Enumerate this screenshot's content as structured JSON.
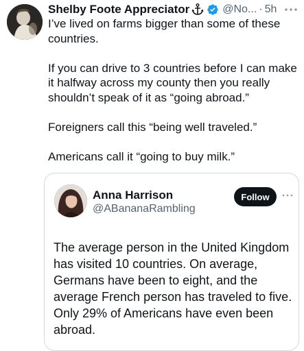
{
  "tweet": {
    "author": {
      "display_name": "Shelby Foote Appreciator",
      "badge_icon": "anchor-icon",
      "verified_icon": "verified-badge-icon",
      "verified_color": "#1d9bf0",
      "handle": "@No...",
      "separator": "·",
      "time": "5h"
    },
    "more_icon": "more-icon",
    "paragraphs": [
      "I’ve lived on farms bigger than some of these countries.",
      "If you can drive to 3 countries before I can make it halfway across my county then you really shouldn’t speak of it as “going abroad.”",
      "Foreigners call this “being well traveled.”",
      "Americans call it “going to buy milk.”"
    ]
  },
  "quote": {
    "author": {
      "display_name": "Anna Harrison",
      "handle": "@ABananaRambling"
    },
    "follow_label": "Follow",
    "more_icon": "more-icon",
    "text": "The average person in the United Kingdom has visited 10 countries. On average, Germans have been to eight, and the average French person has traveled to five. Only 29% of Americans have even been abroad."
  },
  "colors": {
    "text": "#0f1419",
    "secondary": "#536471",
    "border": "#cfd9de",
    "follow_bg": "#0f1419",
    "follow_text": "#ffffff"
  }
}
